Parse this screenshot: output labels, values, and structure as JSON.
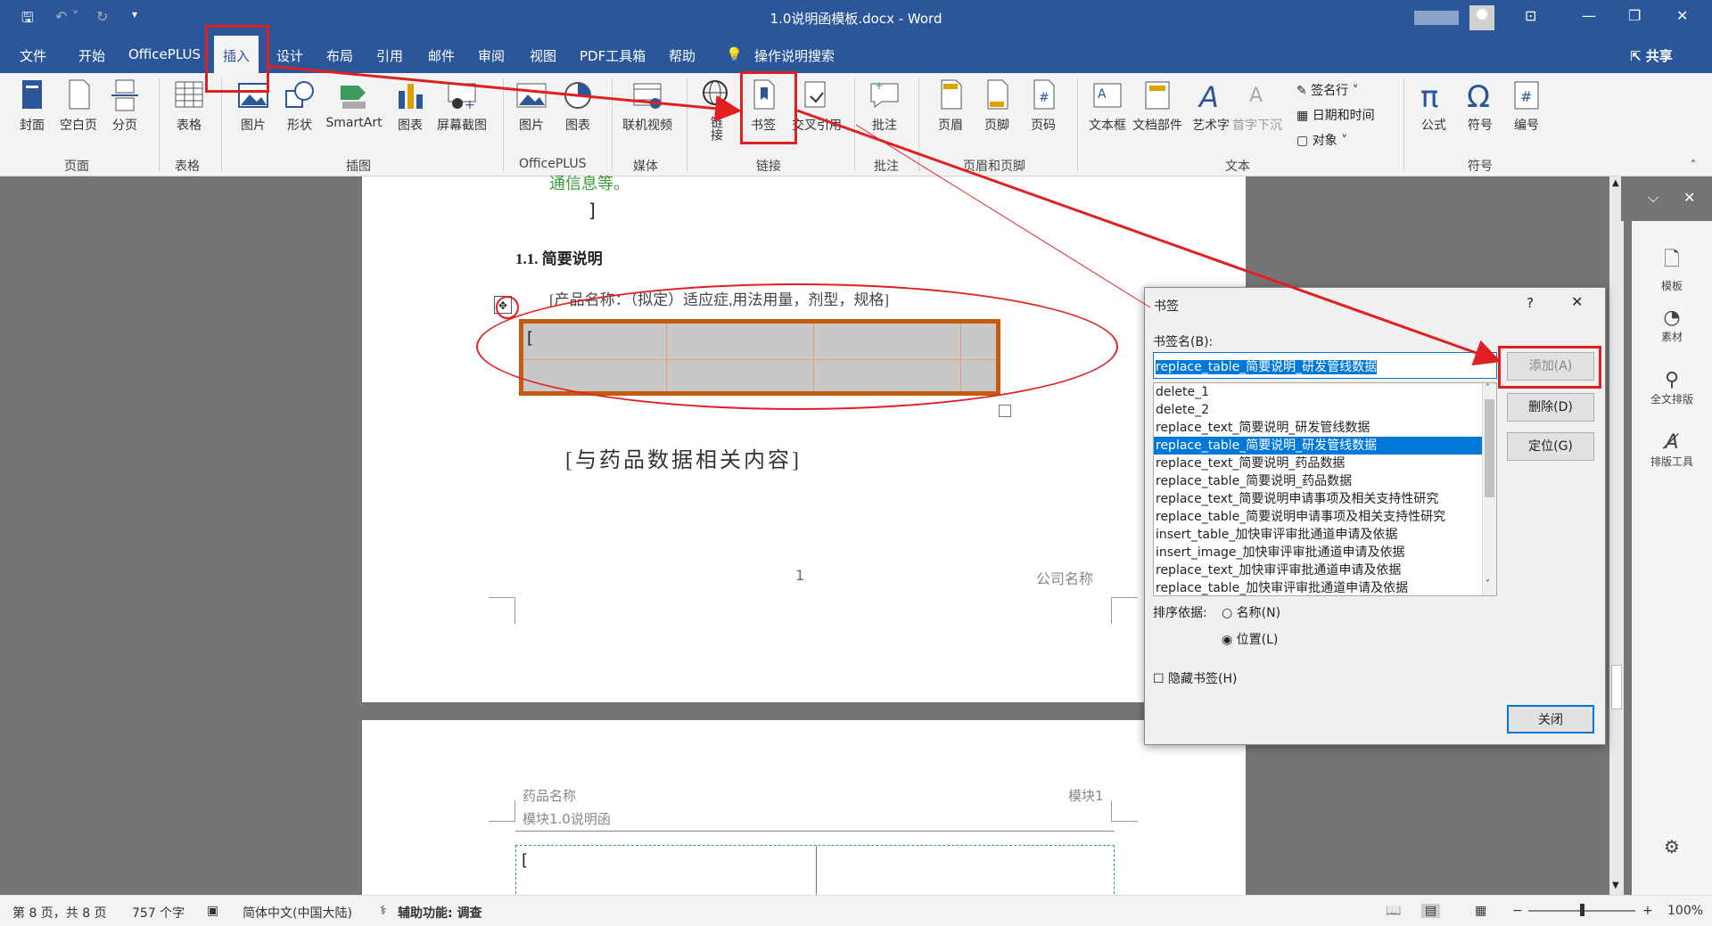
{
  "window": {
    "title": "1.0说明函模板.docx  -  Word",
    "share": "共享"
  },
  "menu": {
    "tabs": [
      "文件",
      "开始",
      "OfficePLUS",
      "插入",
      "设计",
      "布局",
      "引用",
      "邮件",
      "审阅",
      "视图",
      "PDF工具箱",
      "帮助"
    ],
    "active_tab": "插入",
    "search": "操作说明搜索"
  },
  "ribbon": {
    "buttons": {
      "cover": "封面",
      "blank": "空白页",
      "pagebreak": "分页",
      "table": "表格",
      "picture": "图片",
      "shapes": "形状",
      "smartart": "SmartArt",
      "chart": "图表",
      "screenshot": "屏幕截图",
      "oplus_pic": "图片",
      "oplus_chart": "图表",
      "video": "联机视频",
      "link": "链接",
      "bookmark": "书签",
      "crossref": "交叉引用",
      "comment": "批注",
      "header": "页眉",
      "footer": "页脚",
      "pagenum": "页码",
      "textbox": "文本框",
      "parts": "文档部件",
      "wordart": "艺术字",
      "dropcap": "首字下沉",
      "sigline": "签名行",
      "datetime": "日期和时间",
      "object": "对象",
      "equation": "公式",
      "symbol": "符号",
      "number": "编号"
    },
    "groups": {
      "pages": "页面",
      "tables": "表格",
      "illustrations": "插图",
      "officeplus": "OfficePLUS",
      "media": "媒体",
      "links": "链接",
      "comments": "批注",
      "headerfooter": "页眉和页脚",
      "text": "文本",
      "symbols": "符号"
    }
  },
  "document": {
    "green_text": "通信息等。",
    "bracket": "]",
    "heading": "1.1. 简要说明",
    "paragraph": "[产品名称：（拟定）适应症,用法用量，剂型，规格]",
    "table_bracket": "[",
    "drug_text": "[与药品数据相关内容]",
    "page_number": "1",
    "company": "公司名称",
    "header_left": "药品名称",
    "header_right": "模块1",
    "header_sub": "模块1.0说明函",
    "table2_bracket": "["
  },
  "dialog": {
    "title": "书签",
    "help": "?",
    "label_name": "书签名(B):",
    "name_value": "replace_table_简要说明_研发管线数据",
    "items": [
      "delete_1",
      "delete_2",
      "replace_text_简要说明_研发管线数据",
      "replace_table_简要说明_研发管线数据",
      "replace_text_简要说明_药品数据",
      "replace_table_简要说明_药品数据",
      "replace_text_简要说明申请事项及相关支持性研究",
      "replace_table_简要说明申请事项及相关支持性研究",
      "insert_table_加快审评审批通道申请及依据",
      "insert_image_加快审评审批通道申请及依据",
      "replace_text_加快审评审批通道申请及依据",
      "replace_table_加快审评审批通道申请及依据"
    ],
    "selected_index": 3,
    "add": "添加(A)",
    "delete": "删除(D)",
    "goto": "定位(G)",
    "sort_label": "排序依据:",
    "sort_name": "名称(N)",
    "sort_position": "位置(L)",
    "hidden": "隐藏书签(H)",
    "close": "关闭"
  },
  "sidepane": {
    "items": [
      "模板",
      "素材",
      "全文排版",
      "排版工具"
    ]
  },
  "status": {
    "page": "第 8 页，共 8 页",
    "words": "757 个字",
    "lang": "简体中文(中国大陆)",
    "access": "辅助功能: 调查",
    "zoom": "100%"
  }
}
